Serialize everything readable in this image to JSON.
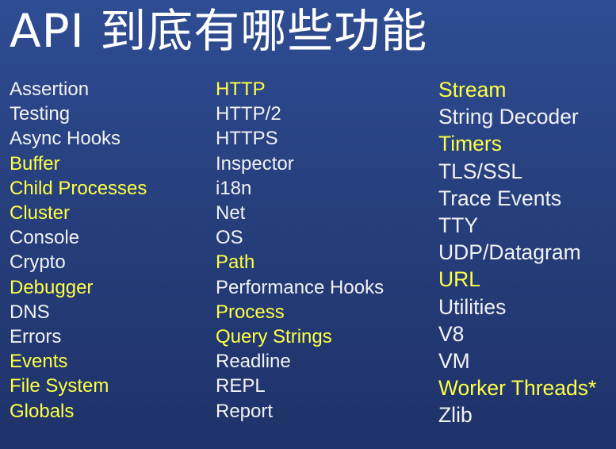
{
  "colors": {
    "background": "#263f7d",
    "text": "#f2f2f2",
    "highlight": "#ffff44"
  },
  "title": "API 到底有哪些功能",
  "columns": [
    {
      "items": [
        {
          "label": "Assertion",
          "highlight": false
        },
        {
          "label": "Testing",
          "highlight": false
        },
        {
          "label": "Async Hooks",
          "highlight": false
        },
        {
          "label": "Buffer",
          "highlight": true
        },
        {
          "label": "Child Processes",
          "highlight": true
        },
        {
          "label": "Cluster",
          "highlight": true
        },
        {
          "label": "Console",
          "highlight": false
        },
        {
          "label": "Crypto",
          "highlight": false
        },
        {
          "label": "Debugger",
          "highlight": true
        },
        {
          "label": "DNS",
          "highlight": false
        },
        {
          "label": "Errors",
          "highlight": false
        },
        {
          "label": "Events",
          "highlight": true
        },
        {
          "label": "File System",
          "highlight": true
        },
        {
          "label": "Globals",
          "highlight": true
        }
      ]
    },
    {
      "items": [
        {
          "label": "HTTP",
          "highlight": true
        },
        {
          "label": "HTTP/2",
          "highlight": false
        },
        {
          "label": "HTTPS",
          "highlight": false
        },
        {
          "label": "Inspector",
          "highlight": false
        },
        {
          "label": "i18n",
          "highlight": false
        },
        {
          "label": "Net",
          "highlight": false
        },
        {
          "label": "OS",
          "highlight": false
        },
        {
          "label": "Path",
          "highlight": true
        },
        {
          "label": "Performance Hooks",
          "highlight": false
        },
        {
          "label": "Process",
          "highlight": true
        },
        {
          "label": "Query Strings",
          "highlight": true
        },
        {
          "label": "Readline",
          "highlight": false
        },
        {
          "label": "REPL",
          "highlight": false
        },
        {
          "label": "Report",
          "highlight": false
        }
      ]
    },
    {
      "items": [
        {
          "label": "Stream",
          "highlight": true
        },
        {
          "label": "String Decoder",
          "highlight": false
        },
        {
          "label": "Timers",
          "highlight": true
        },
        {
          "label": "TLS/SSL",
          "highlight": false
        },
        {
          "label": "Trace Events",
          "highlight": false
        },
        {
          "label": "TTY",
          "highlight": false
        },
        {
          "label": "UDP/Datagram",
          "highlight": false
        },
        {
          "label": "URL",
          "highlight": true
        },
        {
          "label": "Utilities",
          "highlight": false
        },
        {
          "label": "V8",
          "highlight": false
        },
        {
          "label": "VM",
          "highlight": false
        },
        {
          "label": "Worker Threads*",
          "highlight": true
        },
        {
          "label": "Zlib",
          "highlight": false
        }
      ]
    }
  ]
}
